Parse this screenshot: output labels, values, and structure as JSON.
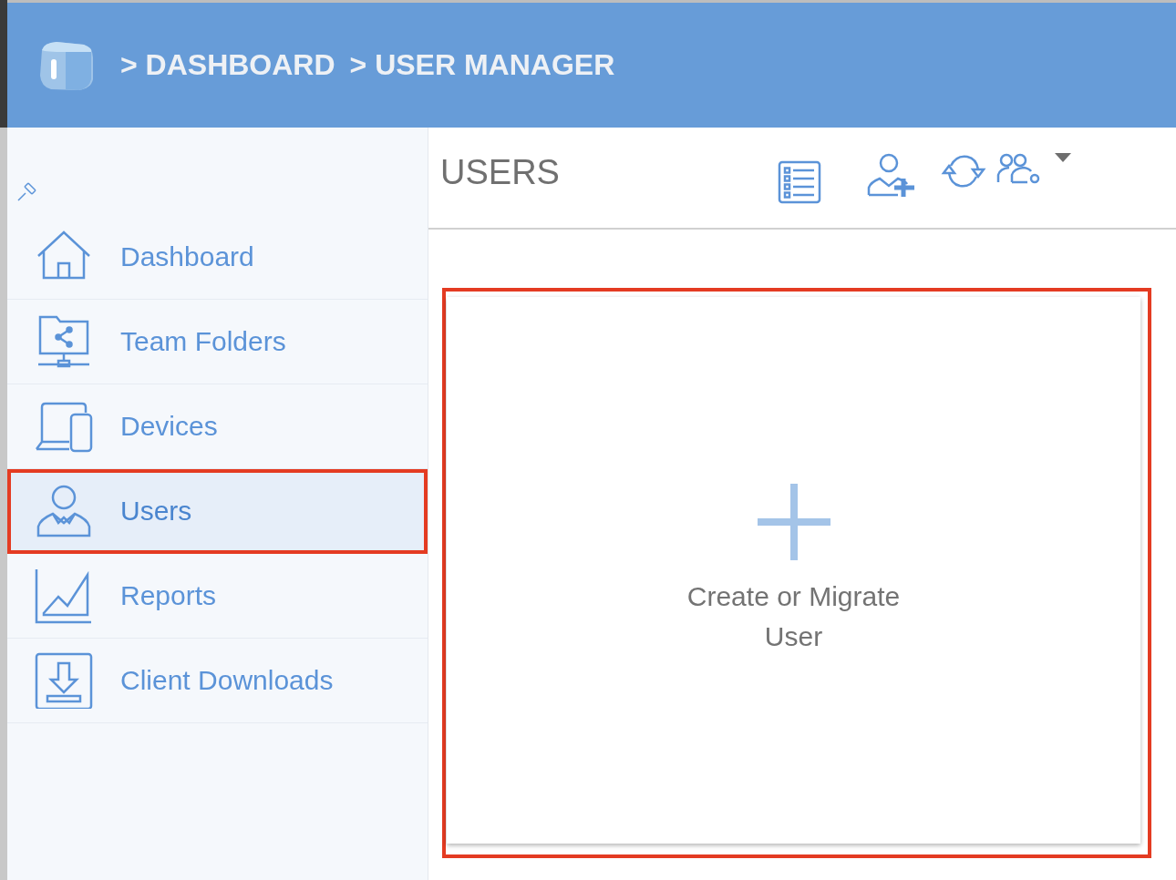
{
  "header": {
    "breadcrumbs": [
      {
        "separator": ">",
        "label": "DASHBOARD"
      },
      {
        "separator": ">",
        "label": "USER MANAGER"
      }
    ]
  },
  "sidebar": {
    "items": [
      {
        "label": "Dashboard",
        "selected": false,
        "highlighted": false
      },
      {
        "label": "Team Folders",
        "selected": false,
        "highlighted": false
      },
      {
        "label": "Devices",
        "selected": false,
        "highlighted": false
      },
      {
        "label": "Users",
        "selected": true,
        "highlighted": true
      },
      {
        "label": "Reports",
        "selected": false,
        "highlighted": false
      },
      {
        "label": "Client Downloads",
        "selected": false,
        "highlighted": false
      }
    ]
  },
  "main": {
    "title": "USERS",
    "card": {
      "label": "Create or Migrate User",
      "highlighted": true
    }
  }
}
